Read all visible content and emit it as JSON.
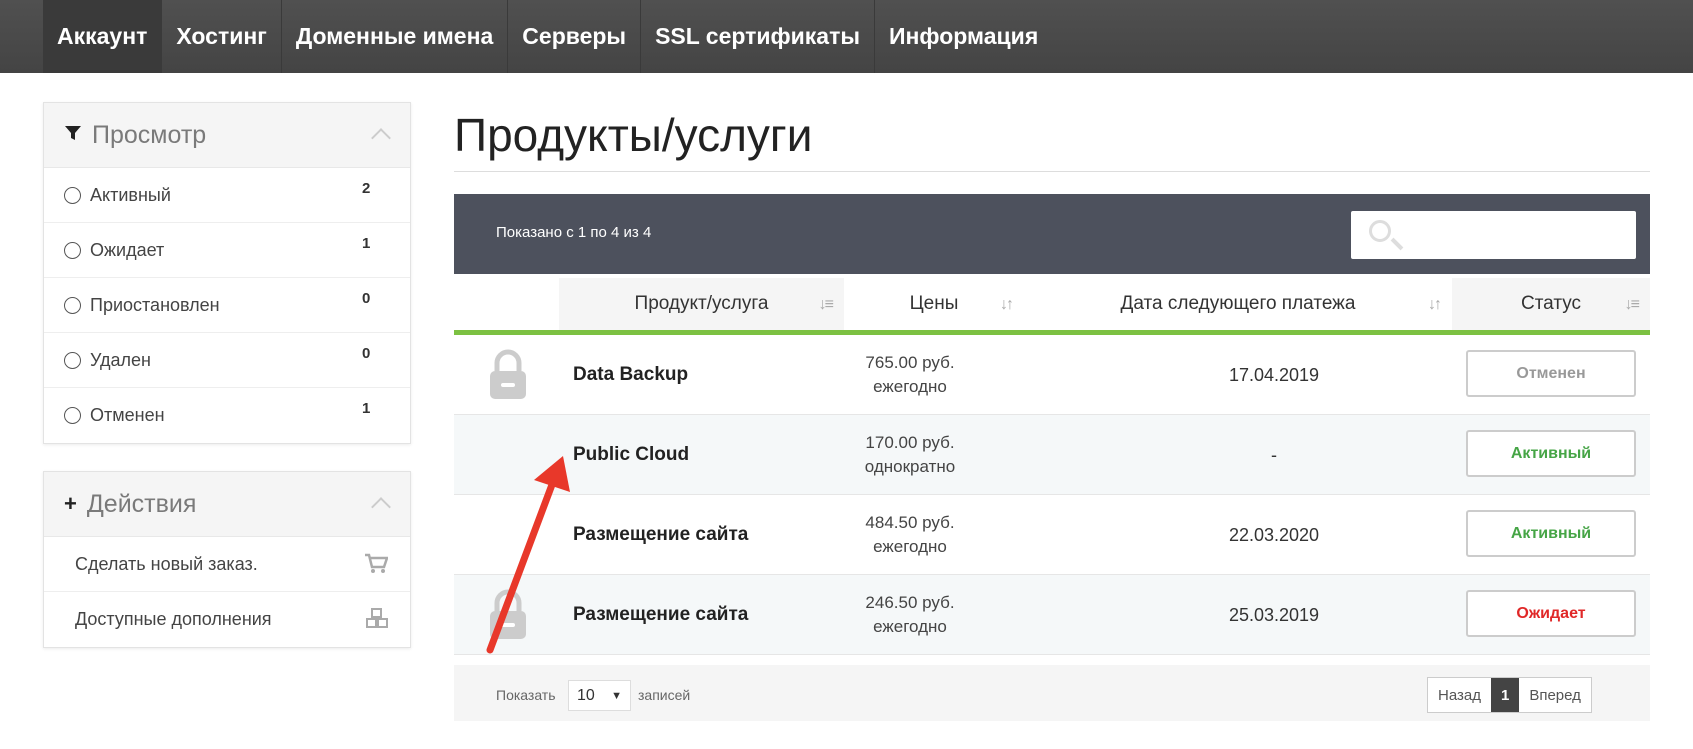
{
  "nav": {
    "items": [
      "Аккаунт",
      "Хостинг",
      "Доменные имена",
      "Серверы",
      "SSL сертификаты",
      "Информация"
    ]
  },
  "view_panel": {
    "title": "Просмотр",
    "filters": [
      {
        "label": "Активный",
        "count": "2"
      },
      {
        "label": "Ожидает",
        "count": "1"
      },
      {
        "label": "Приостановлен",
        "count": "0"
      },
      {
        "label": "Удален",
        "count": "0"
      },
      {
        "label": "Отменен",
        "count": "1"
      }
    ]
  },
  "actions_panel": {
    "title": "Действия",
    "items": [
      {
        "label": "Сделать новый заказ.",
        "icon": "cart-icon"
      },
      {
        "label": "Доступные дополнения",
        "icon": "cubes-icon"
      }
    ]
  },
  "page": {
    "title": "Продукты/услуги"
  },
  "table": {
    "info": "Показано с 1 по 4 из 4",
    "columns": [
      "Продукт/услуга",
      "Цены",
      "Дата следующего платежа",
      "Статус"
    ],
    "rows": [
      {
        "product": "Data Backup",
        "price": "765.00 руб.",
        "cycle": "ежегодно",
        "date": "17.04.2019",
        "status": "Отменен",
        "status_color": "#999999",
        "locked": true
      },
      {
        "product": "Public Cloud",
        "price": "170.00 руб.",
        "cycle": "однократно",
        "date": "-",
        "status": "Активный",
        "status_color": "#46a546",
        "locked": false
      },
      {
        "product": "Размещение сайта",
        "price": "484.50 руб.",
        "cycle": "ежегодно",
        "date": "22.03.2020",
        "status": "Активный",
        "status_color": "#46a546",
        "locked": false
      },
      {
        "product": "Размещение сайта",
        "price": "246.50 руб.",
        "cycle": "ежегодно",
        "date": "25.03.2019",
        "status": "Ожидает",
        "status_color": "#e02828",
        "locked": true
      }
    ],
    "footer": {
      "show_label": "Показать",
      "page_size": "10",
      "records_label": "записей",
      "prev": "Назад",
      "current_page": "1",
      "next": "Вперед"
    }
  },
  "colors": {
    "nav_bg": "#4a4a4a",
    "table_header_bg": "#4d515d",
    "accent_green": "#7cc142",
    "annotation_arrow": "#e8382a"
  }
}
